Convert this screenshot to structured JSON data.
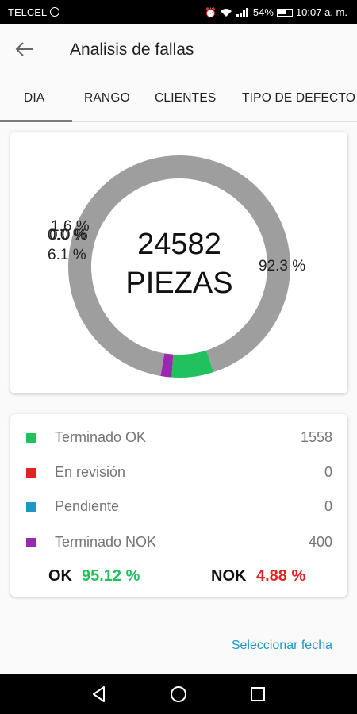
{
  "status_bar": {
    "carrier": "TELCEL",
    "battery": "54%",
    "time": "10:07 a. m.",
    "icons": [
      "whatsapp-icon",
      "alarm-icon",
      "wifi-icon",
      "signal-icon",
      "battery-icon"
    ]
  },
  "app_bar": {
    "title": "Analisis de fallas",
    "back_icon": "arrow-back-icon"
  },
  "tabs": [
    {
      "label": "DIA",
      "selected": true
    },
    {
      "label": "RANGO",
      "selected": false
    },
    {
      "label": "CLIENTES",
      "selected": false
    },
    {
      "label": "TIPO DE DEFECTO",
      "selected": false
    }
  ],
  "donut": {
    "center_number": "24582",
    "center_unit": "PIEZAS",
    "labels": [
      "1.6 %",
      "0.0 %",
      "0.0 %",
      "6.1 %",
      "92.3 %"
    ]
  },
  "chart_data": {
    "type": "pie",
    "variant": "donut",
    "slices": [
      {
        "label": "Terminado OK",
        "value": 6.1,
        "color": "#21c25e"
      },
      {
        "label": "En revisión",
        "value": 0.0,
        "color": "#e02424"
      },
      {
        "label": "Pendiente",
        "value": 0.0,
        "color": "#1e96c8"
      },
      {
        "label": "Terminado NOK",
        "value": 1.6,
        "color": "#9c27b0"
      },
      {
        "label": "",
        "value": 92.3,
        "color": "#9e9e9e"
      }
    ]
  },
  "legend": [
    {
      "label": "Terminado OK",
      "value": "1558",
      "color": "#21c25e"
    },
    {
      "label": "En revisión",
      "value": "0",
      "color": "#e02424"
    },
    {
      "label": "Pendiente",
      "value": "0",
      "color": "#1e96c8"
    },
    {
      "label": "Terminado NOK",
      "value": "400",
      "color": "#9c27b0"
    }
  ],
  "summary": {
    "ok_label": "OK",
    "ok_value": "95.12 %",
    "nok_label": "NOK",
    "nok_value": "4.88 %"
  },
  "select_date": "Seleccionar fecha",
  "nav_icons": [
    "back-triangle-icon",
    "home-circle-icon",
    "recents-square-icon"
  ]
}
